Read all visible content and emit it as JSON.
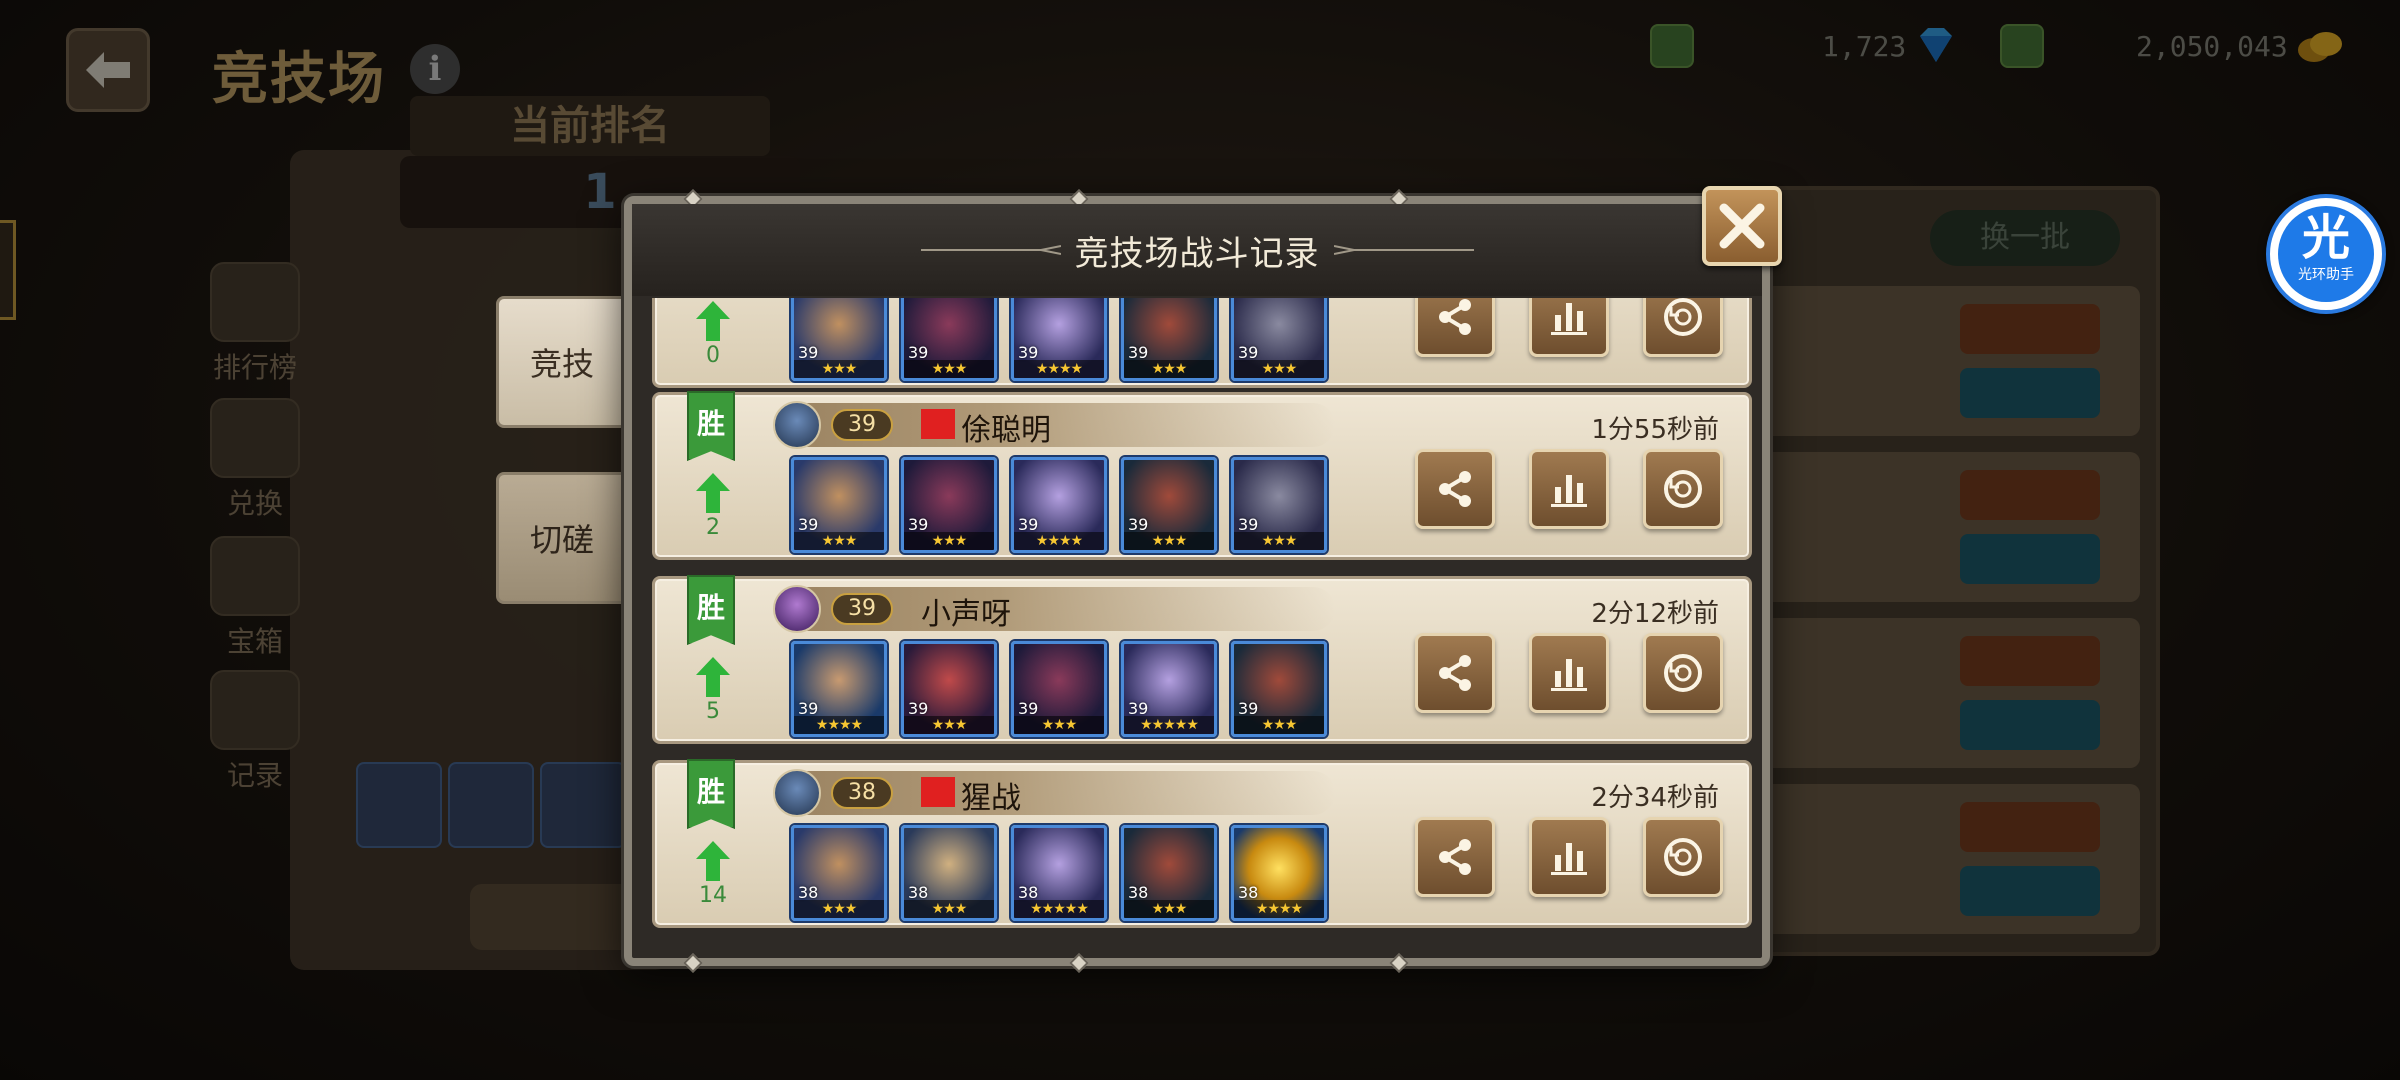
{
  "background": {
    "title": "竞技场",
    "rank_banner": "当前排名",
    "rank_value": "1",
    "currency_gems": "1,723",
    "currency_gold": "2,050,043",
    "swap_button": "换一批",
    "side_nav": [
      "排行榜",
      "兑换",
      "宝箱",
      "记录"
    ]
  },
  "modal": {
    "title": "竞技场战斗记录",
    "tabs": [
      {
        "label": "竞技",
        "active": true
      },
      {
        "label": "切磋",
        "active": false
      }
    ],
    "records": [
      {
        "result": "",
        "rank_change": "0",
        "level": "",
        "name": "",
        "time": "",
        "heroes": [
          {
            "type": "h-dwarf",
            "level": "39",
            "stars": "★★★"
          },
          {
            "type": "h-ogre",
            "level": "39",
            "stars": "★★★"
          },
          {
            "type": "h-ghost",
            "level": "39",
            "stars": "★★★★"
          },
          {
            "type": "h-rogue",
            "level": "39",
            "stars": "★★★"
          },
          {
            "type": "h-beast",
            "level": "39",
            "stars": "★★★"
          }
        ]
      },
      {
        "result": "胜",
        "rank_change": "2",
        "level": "39",
        "name": "俆聪明",
        "flag": true,
        "avatar": "blue",
        "time": "1分55秒前",
        "heroes": [
          {
            "type": "h-dwarf",
            "level": "39",
            "stars": "★★★"
          },
          {
            "type": "h-ogre",
            "level": "39",
            "stars": "★★★"
          },
          {
            "type": "h-ghost",
            "level": "39",
            "stars": "★★★★"
          },
          {
            "type": "h-rogue",
            "level": "39",
            "stars": "★★★"
          },
          {
            "type": "h-beast",
            "level": "39",
            "stars": "★★★"
          }
        ]
      },
      {
        "result": "胜",
        "rank_change": "5",
        "level": "39",
        "name": "小声呀",
        "flag": false,
        "avatar": "purple",
        "time": "2分12秒前",
        "heroes": [
          {
            "type": "h-pirate",
            "level": "39",
            "stars": "★★★★"
          },
          {
            "type": "h-redogre",
            "level": "39",
            "stars": "★★★"
          },
          {
            "type": "h-ogre",
            "level": "39",
            "stars": "★★★"
          },
          {
            "type": "h-ghost",
            "level": "39",
            "stars": "★★★★★"
          },
          {
            "type": "h-rogue",
            "level": "39",
            "stars": "★★★"
          }
        ]
      },
      {
        "result": "胜",
        "rank_change": "14",
        "level": "38",
        "name": "猩战",
        "flag": true,
        "avatar": "blue",
        "time": "2分34秒前",
        "heroes": [
          {
            "type": "h-dwarf",
            "level": "38",
            "stars": "★★★"
          },
          {
            "type": "h-warrior",
            "level": "38",
            "stars": "★★★"
          },
          {
            "type": "h-ghost",
            "level": "38",
            "stars": "★★★★★"
          },
          {
            "type": "h-rogue",
            "level": "38",
            "stars": "★★★"
          },
          {
            "type": "h-gold",
            "level": "38",
            "stars": "★★★★"
          }
        ]
      }
    ]
  },
  "overlay_app": {
    "icon_char": "光",
    "label": "光环助手"
  },
  "colors": {
    "win_green": "#3b9a3a",
    "button_brown": "#8a5e30",
    "hero_frame_blue": "#4a8ad8",
    "panel_cream": "#efe6d4"
  }
}
